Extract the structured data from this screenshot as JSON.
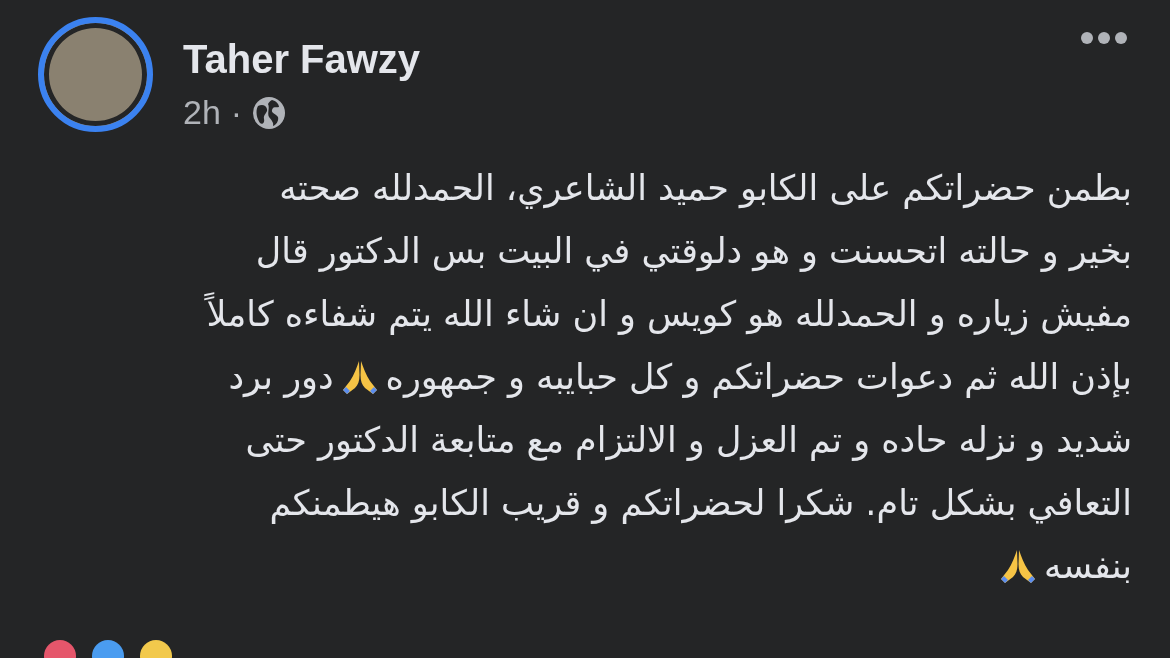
{
  "post": {
    "author": "Taher Fawzy",
    "time": "2h",
    "separator": "·",
    "lines": [
      [
        {
          "kind": "text",
          "text": "بطمن حضراتكم على الكابو حميد الشاعري، الحمدلله صحته"
        }
      ],
      [
        {
          "kind": "text",
          "text": "بخير و حالته اتحسنت و هو دلوقتي في البيت بس الدكتور قال"
        }
      ],
      [
        {
          "kind": "text",
          "text": "مفيش زياره و الحمدلله هو كويس و ان شاء الله يتم شفاءه كاملاً"
        }
      ],
      [
        {
          "kind": "text",
          "text": "بإذن الله ثم دعوات حضراتكم و كل حبايبه و جمهوره"
        },
        {
          "kind": "icon"
        },
        {
          "kind": "text",
          "text": "دور برد"
        }
      ],
      [
        {
          "kind": "text",
          "text": "شديد و نزله حاده و تم العزل و الالتزام مع متابعة الدكتور حتى"
        }
      ],
      [
        {
          "kind": "text",
          "text": "التعافي بشكل تام. شكرا لحضراتكم و قريب الكابو هيطمنكم"
        }
      ],
      [
        {
          "kind": "text",
          "text": "بنفسه"
        },
        {
          "kind": "icon"
        }
      ]
    ]
  }
}
